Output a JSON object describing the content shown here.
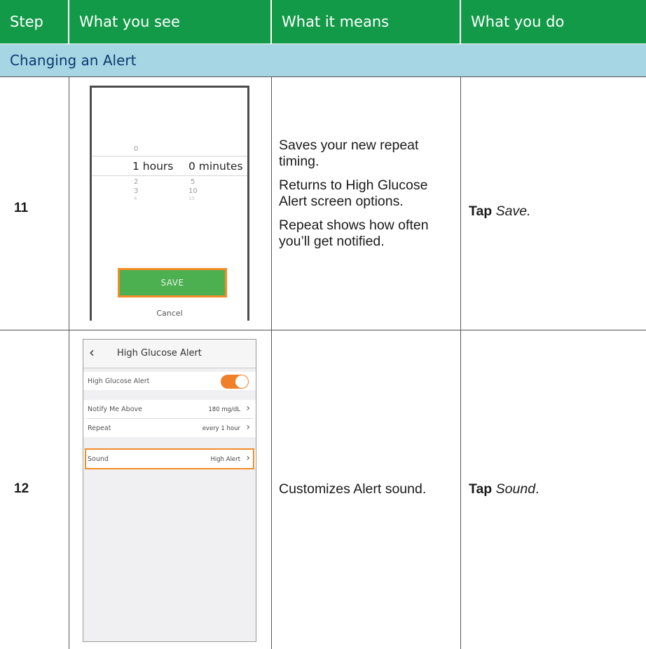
{
  "header": {
    "step": "Step",
    "what_you_see": "What you see",
    "what_it_means": "What it means",
    "what_you_do": "What you do"
  },
  "section_title": "Changing an Alert",
  "colors": {
    "header_bg": "#139a48",
    "section_bg": "#a6d6e4",
    "section_text": "#0b3a6e",
    "highlight": "#f28c28",
    "save_button": "#4caf50",
    "toggle_on": "#f07f2a"
  },
  "rows": [
    {
      "step": "11",
      "means": [
        "Saves your new repeat timing.",
        "Returns to High Glucose Alert screen options.",
        "Repeat shows how often you’ll get notified."
      ],
      "do_action": "Tap",
      "do_target": "Save.",
      "screen": {
        "picker_above": "0",
        "selected_hours": "1 hours",
        "selected_minutes": "0 minutes",
        "below_hours_1": "2",
        "below_minutes_1": "5",
        "below_hours_2": "3",
        "below_minutes_2": "10",
        "below_hours_3": "4",
        "below_minutes_3": "15",
        "save_label": "SAVE",
        "cancel_label": "Cancel"
      }
    },
    {
      "step": "12",
      "means": [
        "Customizes Alert sound."
      ],
      "do_action": "Tap",
      "do_target": "Sound",
      "do_suffix": ".",
      "screen": {
        "back_icon": "chevron-left-icon",
        "title": "High Glucose Alert",
        "toggle_label": "High Glucose Alert",
        "notify_label": "Notify Me Above",
        "notify_value": "180 mg/dL",
        "repeat_label": "Repeat",
        "repeat_value": "every 1 hour",
        "sound_label": "Sound",
        "sound_value": "High Alert"
      }
    }
  ]
}
